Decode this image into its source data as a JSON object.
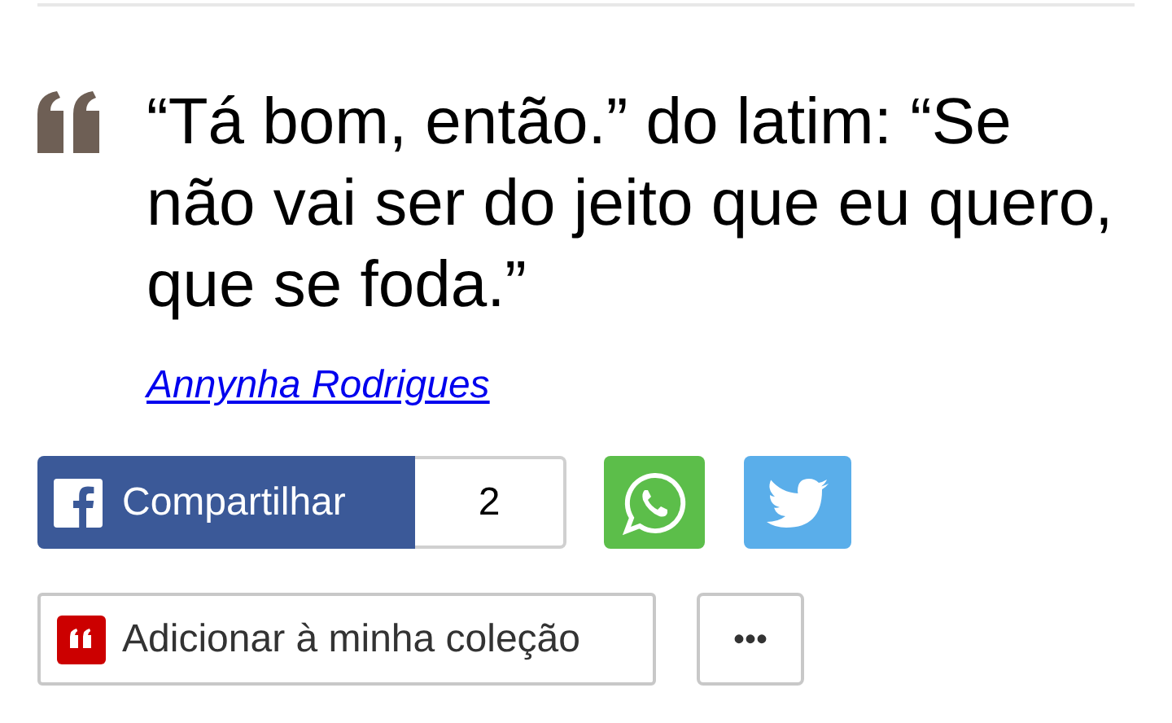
{
  "quote": {
    "text": "“Tá bom, então.” do latim: “Se não vai ser do jeito que eu quero, que se foda.”",
    "author": "Annynha Rodrigues"
  },
  "share": {
    "facebook_label": "Compartilhar",
    "count": "2"
  },
  "actions": {
    "collection_label": "Adicionar à minha coleção",
    "more_label": "•••"
  }
}
